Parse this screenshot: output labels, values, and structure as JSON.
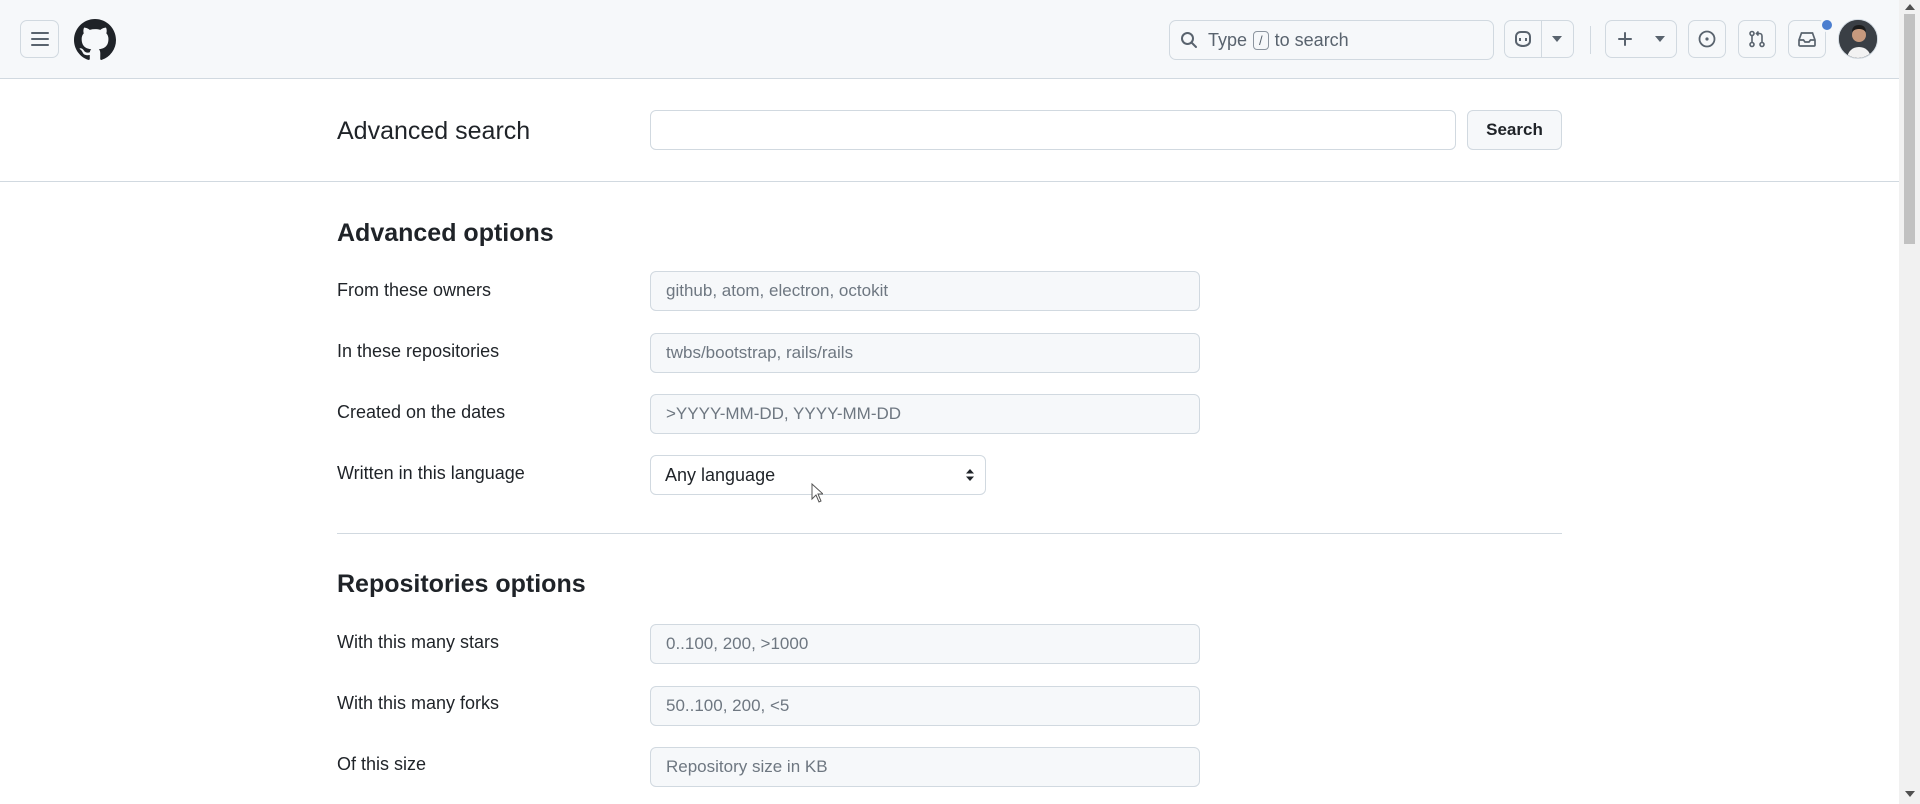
{
  "header": {
    "search_prefix": "Type",
    "search_key": "/",
    "search_suffix": "to search"
  },
  "search_bar": {
    "title": "Advanced search",
    "value": "",
    "button_label": "Search"
  },
  "advanced_options": {
    "heading": "Advanced options",
    "fields": [
      {
        "label": "From these owners",
        "placeholder": "github, atom, electron, octokit"
      },
      {
        "label": "In these repositories",
        "placeholder": "twbs/bootstrap, rails/rails"
      },
      {
        "label": "Created on the dates",
        "placeholder": ">YYYY-MM-DD, YYYY-MM-DD"
      }
    ],
    "language": {
      "label": "Written in this language",
      "selected": "Any language"
    }
  },
  "repositories_options": {
    "heading": "Repositories options",
    "fields": [
      {
        "label": "With this many stars",
        "placeholder": "0..100, 200, >1000"
      },
      {
        "label": "With this many forks",
        "placeholder": "50..100, 200, <5"
      },
      {
        "label": "Of this size",
        "placeholder": "Repository size in KB"
      }
    ]
  },
  "colors": {
    "header_bg": "#f6f8fa",
    "border": "#d1d9e0",
    "text": "#1f2328",
    "notification_dot": "#4b7ecf"
  },
  "icons": [
    "hamburger-icon",
    "github-logo-icon",
    "search-icon",
    "copilot-icon",
    "chevron-down-icon",
    "plus-icon",
    "issues-icon",
    "pull-request-icon",
    "inbox-icon",
    "select-arrows-icon"
  ]
}
